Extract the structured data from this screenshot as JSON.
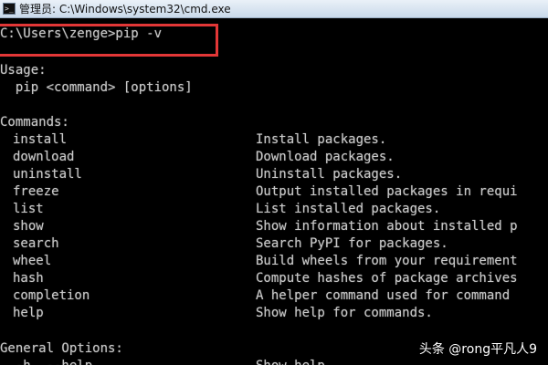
{
  "window": {
    "title": "管理员: C:\\Windows\\system32\\cmd.exe",
    "icon": "cmd-icon",
    "icon_glyph": ">_"
  },
  "console": {
    "prompt": "C:\\Users\\zenge>pip -v",
    "usage_header": "Usage:",
    "usage_line": "  pip <command> [options]",
    "commands_header": "Commands:",
    "commands": [
      {
        "name": "install",
        "desc": "Install packages."
      },
      {
        "name": "download",
        "desc": "Download packages."
      },
      {
        "name": "uninstall",
        "desc": "Uninstall packages."
      },
      {
        "name": "freeze",
        "desc": "Output installed packages in requi"
      },
      {
        "name": "list",
        "desc": "List installed packages."
      },
      {
        "name": "show",
        "desc": "Show information about installed p"
      },
      {
        "name": "search",
        "desc": "Search PyPI for packages."
      },
      {
        "name": "wheel",
        "desc": "Build wheels from your requirement"
      },
      {
        "name": "hash",
        "desc": "Compute hashes of package archives"
      },
      {
        "name": "completion",
        "desc": "A helper command used for command"
      },
      {
        "name": "help",
        "desc": "Show help for commands."
      }
    ],
    "general_header": "General Options:",
    "partial_line": "  -h, --help",
    "partial_desc": "Show help."
  },
  "annotation": {
    "color": "#e23737"
  },
  "watermark": {
    "text": "头条 @rong平凡人9"
  }
}
